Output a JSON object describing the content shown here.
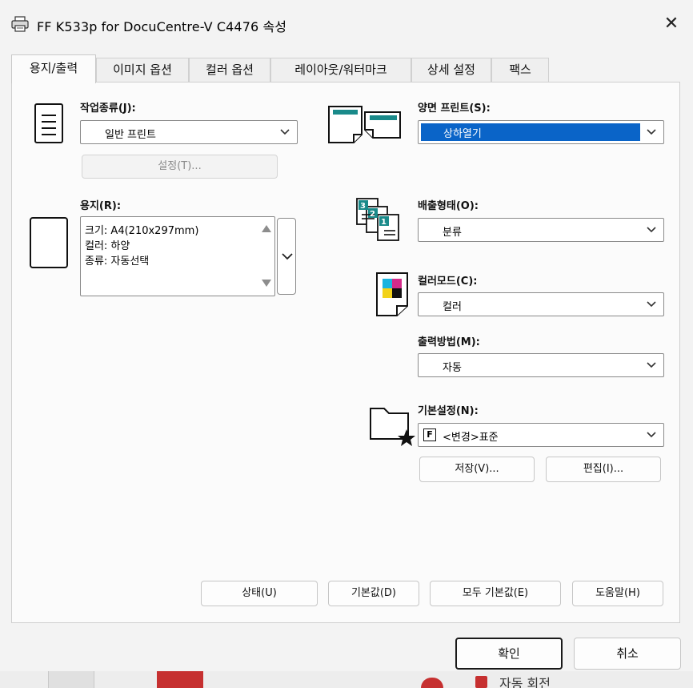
{
  "window": {
    "title": "FF K533p for DocuCentre-V C4476 속성"
  },
  "tabs": [
    {
      "label": "용지/출력"
    },
    {
      "label": "이미지 옵션"
    },
    {
      "label": "컬러 옵션"
    },
    {
      "label": "레이아웃/워터마크"
    },
    {
      "label": "상세 설정"
    },
    {
      "label": "팩스"
    }
  ],
  "job_type": {
    "label": "작업종류(J):",
    "value": "일반 프린트",
    "settings_button": "설정(T)..."
  },
  "paper": {
    "label": "용지(R):",
    "lines": [
      "크기: A4(210x297mm)",
      "컬러: 하양",
      "종류: 자동선택"
    ]
  },
  "duplex": {
    "label": "양면 프린트(S):",
    "value": "상하열기"
  },
  "output_type": {
    "label": "배출형태(O):",
    "value": "분류",
    "badges": [
      "3",
      "2",
      "1"
    ]
  },
  "color_mode": {
    "label": "컬러모드(C):",
    "value": "컬러"
  },
  "output_method": {
    "label": "출력방법(M):",
    "value": "자동"
  },
  "favorites": {
    "label": "기본설정(N):",
    "badge": "F",
    "value": "<변경>표준",
    "save_button": "저장(V)...",
    "edit_button": "편집(I)..."
  },
  "bottom_buttons": {
    "status": "상태(U)",
    "defaults": "기본값(D)",
    "all_defaults": "모두 기본값(E)",
    "help": "도움말(H)"
  },
  "dialog_buttons": {
    "ok": "확인",
    "cancel": "취소"
  },
  "background": {
    "partial_text": "자동 회전"
  },
  "colors": {
    "accent": "#0a64c8",
    "teal": "#1a8a8a"
  }
}
